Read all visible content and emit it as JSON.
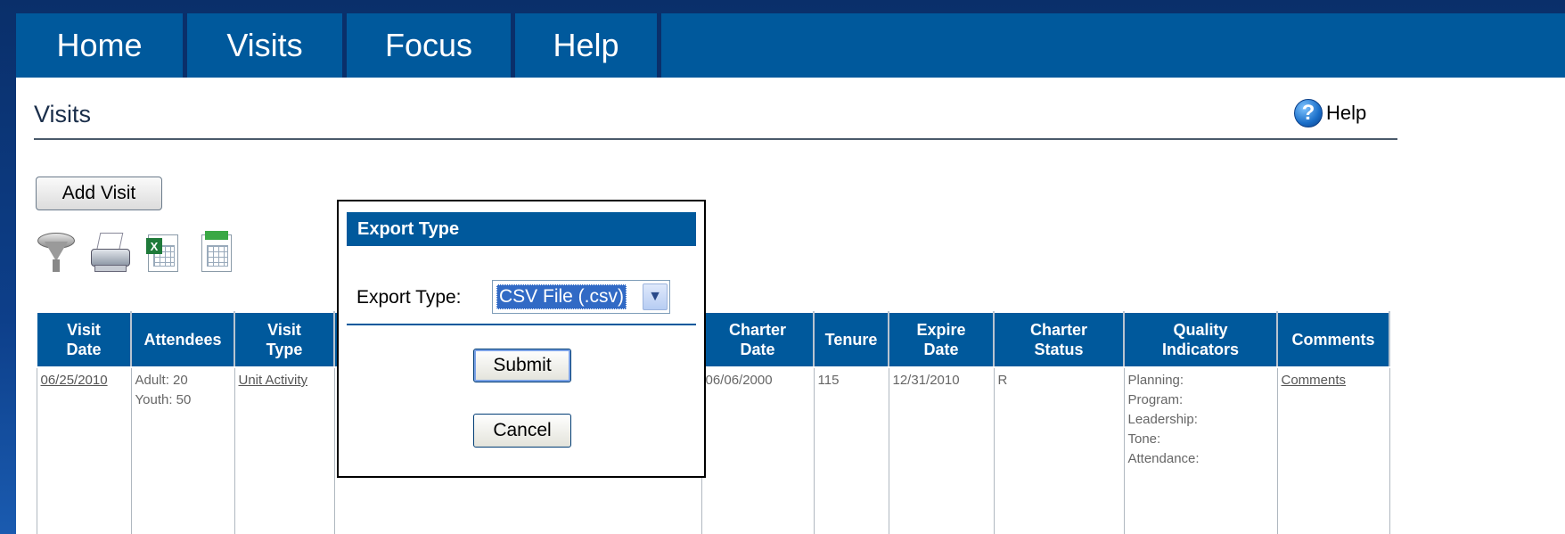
{
  "nav": {
    "tabs": [
      {
        "label": "Home"
      },
      {
        "label": "Visits"
      },
      {
        "label": "Focus"
      },
      {
        "label": "Help"
      }
    ]
  },
  "page": {
    "title": "Visits",
    "help_label": "Help",
    "help_icon": "question-circle-icon",
    "add_visit_label": "Add Visit"
  },
  "toolbar": {
    "icons": [
      "filter-funnel-icon",
      "printer-icon",
      "excel-export-icon",
      "csv-export-icon"
    ]
  },
  "table": {
    "headers": [
      {
        "line1": "Visit",
        "line2": "Date"
      },
      {
        "line1": "Attendees",
        "line2": ""
      },
      {
        "line1": "Visit",
        "line2": "Type"
      },
      {
        "line1": "",
        "line2": ""
      },
      {
        "line1": "Charter",
        "line2": "Date"
      },
      {
        "line1": "Tenure",
        "line2": ""
      },
      {
        "line1": "Expire",
        "line2": "Date"
      },
      {
        "line1": "Charter",
        "line2": "Status"
      },
      {
        "line1": "Quality",
        "line2": "Indicators"
      },
      {
        "line1": "Comments",
        "line2": ""
      }
    ],
    "row": {
      "visit_date": "06/25/2010",
      "attendees": [
        "Adult: 20",
        "Youth: 50"
      ],
      "visit_type": "Unit Activity",
      "hidden": "",
      "charter_date": "06/06/2000",
      "tenure": "115",
      "expire_date": "12/31/2010",
      "charter_status": "R",
      "quality_indicators": [
        "Planning:",
        "Program:",
        "Leadership:",
        "Tone:",
        "Attendance:"
      ],
      "comments": "Comments"
    }
  },
  "dialog": {
    "title": "Export Type",
    "label": "Export Type:",
    "selected": "CSV File (.csv)",
    "submit_label": "Submit",
    "cancel_label": "Cancel"
  },
  "colors": {
    "nav_bg": "#00599c",
    "header_bg": "#00599c",
    "select_highlight": "#316ac5"
  }
}
